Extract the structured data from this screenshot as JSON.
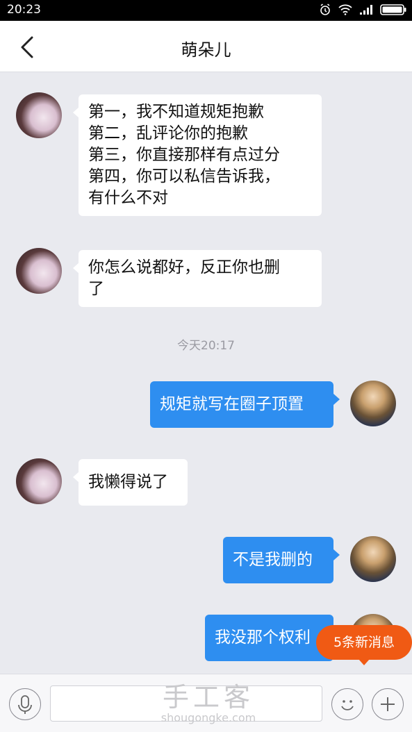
{
  "status": {
    "time": "20:23"
  },
  "header": {
    "title": "萌朵儿"
  },
  "messages": [
    {
      "lines": [
        "第一，我不知道规矩抱歉",
        "第二，乱评论你的抱歉",
        "第三，你直接那样有点过分",
        "第四，你可以私信告诉我，",
        "有什么不对"
      ]
    },
    {
      "lines": [
        "你怎么说都好，反正你也删",
        "了"
      ]
    },
    {
      "lines": [
        "规矩就写在圈子顶置"
      ]
    },
    {
      "lines": [
        "我懒得说了"
      ]
    },
    {
      "lines": [
        "不是我删的"
      ]
    },
    {
      "lines": [
        "我没那个权利"
      ]
    }
  ],
  "timestamp": "今天20:17",
  "new_messages_badge": "5条新消息",
  "watermark": {
    "title": "手工客",
    "url": "shougongke.com"
  },
  "colors": {
    "outgoing_bubble": "#2e8ef0",
    "badge": "#f05a14"
  },
  "icons": [
    "back-chevron-icon",
    "alarm-icon",
    "wifi-icon",
    "signal-icon",
    "battery-icon",
    "microphone-icon",
    "emoji-icon",
    "plus-icon"
  ]
}
